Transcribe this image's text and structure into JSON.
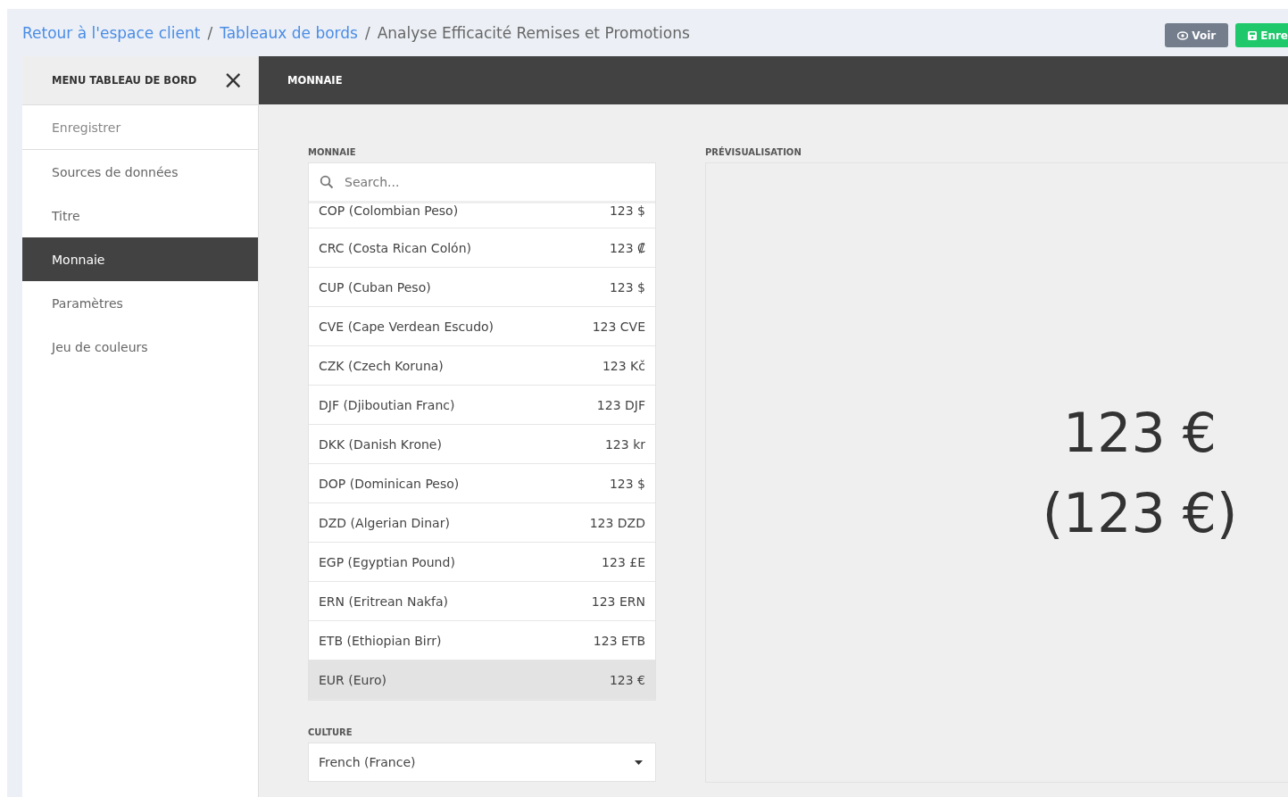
{
  "breadcrumb": [
    {
      "label": "Retour à l'espace client",
      "link": true
    },
    {
      "label": "Tableaux de bords",
      "link": true
    },
    {
      "label": "Analyse Efficacité Remises et Promotions",
      "link": false
    }
  ],
  "separator": "/",
  "actions": [
    {
      "kind": "view",
      "label": "Voir"
    },
    {
      "kind": "save",
      "label": "Enre"
    }
  ],
  "sidebar": {
    "title": "MENU TABLEAU DE BORD",
    "close": "×",
    "items": [
      {
        "label": "Enregistrer",
        "selected": false
      },
      {
        "label": "Sources de données",
        "selected": false
      },
      {
        "label": "Titre",
        "selected": false
      },
      {
        "label": "Monnaie",
        "selected": true
      },
      {
        "label": "Paramètres",
        "selected": false
      },
      {
        "label": "Jeu de couleurs",
        "selected": false
      }
    ]
  },
  "panel_title": "MONNAIE",
  "currency": {
    "label": "MONNAIE",
    "search": {
      "placeholder": "Search..."
    },
    "rows": [
      {
        "name": "COP (Colombian Peso)",
        "sample": "123 $",
        "selected": false
      },
      {
        "name": "CRC (Costa Rican Colón)",
        "sample": "123 ₡",
        "selected": false
      },
      {
        "name": "CUP (Cuban Peso)",
        "sample": "123 $",
        "selected": false
      },
      {
        "name": "CVE (Cape Verdean Escudo)",
        "sample": "123 CVE",
        "selected": false
      },
      {
        "name": "CZK (Czech Koruna)",
        "sample": "123 Kč",
        "selected": false
      },
      {
        "name": "DJF (Djiboutian Franc)",
        "sample": "123 DJF",
        "selected": false
      },
      {
        "name": "DKK (Danish Krone)",
        "sample": "123 kr",
        "selected": false
      },
      {
        "name": "DOP (Dominican Peso)",
        "sample": "123 $",
        "selected": false
      },
      {
        "name": "DZD (Algerian Dinar)",
        "sample": "123 DZD",
        "selected": false
      },
      {
        "name": "EGP (Egyptian Pound)",
        "sample": "123 £E",
        "selected": false
      },
      {
        "name": "ERN (Eritrean Nakfa)",
        "sample": "123 ERN",
        "selected": false
      },
      {
        "name": "ETB (Ethiopian Birr)",
        "sample": "123 ETB",
        "selected": false
      },
      {
        "name": "EUR (Euro)",
        "sample": "123 €",
        "selected": true
      }
    ]
  },
  "culture": {
    "label": "CULTURE",
    "value": "French (France)"
  },
  "preview": {
    "label": "PRÉVISUALISATION",
    "lines": [
      "123 €",
      "(123 €)"
    ]
  }
}
